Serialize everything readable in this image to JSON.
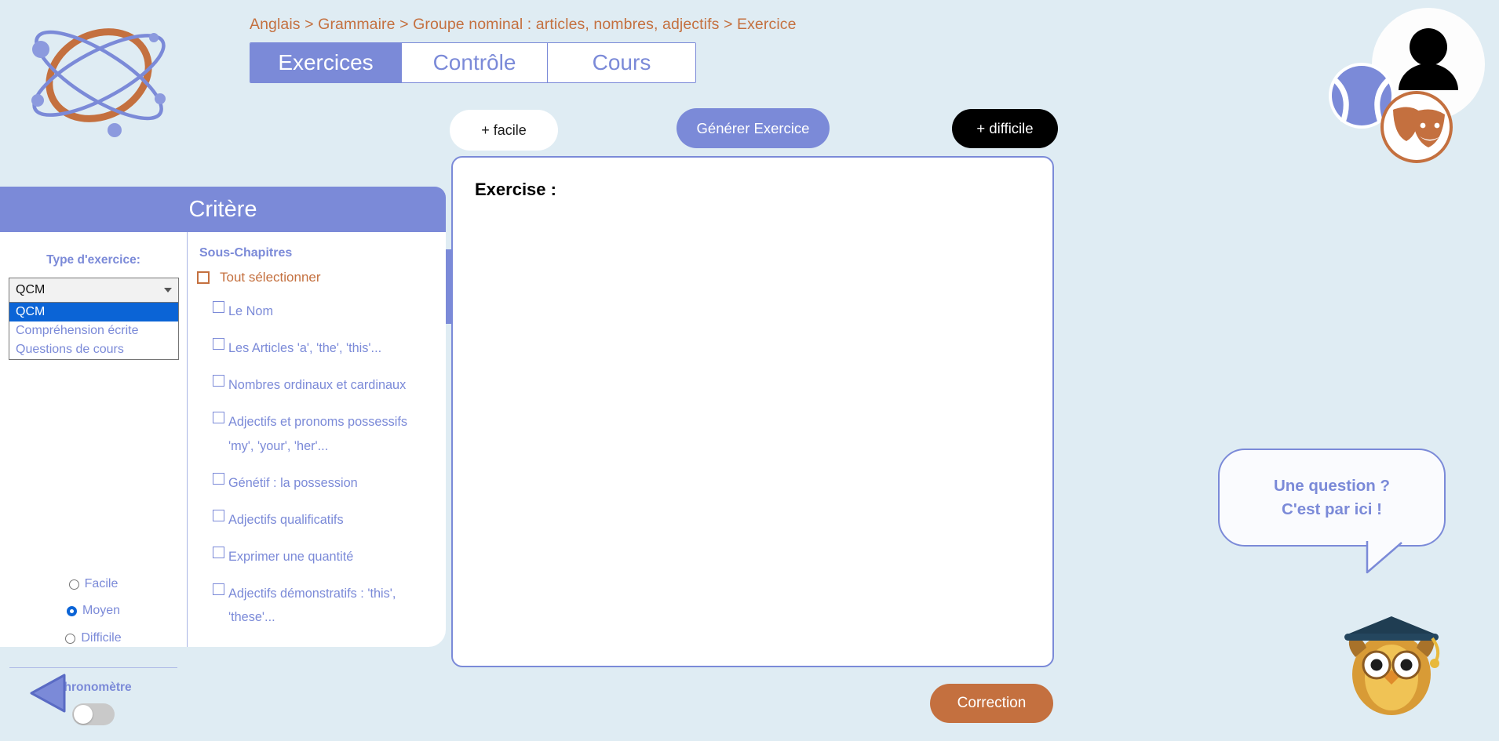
{
  "breadcrumb": {
    "text": "Anglais > Grammaire > Groupe nominal : articles, nombres, adjectifs > Exercice"
  },
  "tabs": [
    {
      "label": "Exercices",
      "active": true
    },
    {
      "label": "Contrôle",
      "active": false
    },
    {
      "label": "Cours",
      "active": false
    }
  ],
  "toolbar": {
    "easier_label": "+ facile",
    "generate_label": "Générer Exercice",
    "harder_label": "+ difficile"
  },
  "criteria": {
    "title": "Critère",
    "exercise_type_label": "Type d'exercice:",
    "exercise_type_value": "QCM",
    "exercise_type_options": [
      {
        "label": "QCM",
        "selected": true
      },
      {
        "label": "Compréhension écrite",
        "selected": false
      },
      {
        "label": "Questions de cours",
        "selected": false
      }
    ],
    "difficulty_options": [
      {
        "label": "Facile",
        "selected": false
      },
      {
        "label": "Moyen",
        "selected": true
      },
      {
        "label": "Difficile",
        "selected": false
      }
    ],
    "chronometer_label": "Chronomètre",
    "chronometer_on": false
  },
  "subchapters": {
    "title": "Sous-Chapitres",
    "select_all_label": "Tout sélectionner",
    "items": [
      {
        "label": "Le Nom",
        "checked": false
      },
      {
        "label": "Les Articles 'a', 'the', 'this'...",
        "checked": false
      },
      {
        "label": "Nombres ordinaux et cardinaux",
        "checked": false
      },
      {
        "label": "Adjectifs et pronoms possessifs 'my', 'your', 'her'...",
        "checked": false
      },
      {
        "label": "Génétif : la possession",
        "checked": false
      },
      {
        "label": "Adjectifs qualificatifs",
        "checked": false
      },
      {
        "label": "Exprimer une quantité",
        "checked": false
      },
      {
        "label": "Adjectifs démonstratifs : 'this', 'these'...",
        "checked": false
      }
    ]
  },
  "collapse": {
    "glyph": "«"
  },
  "exercise": {
    "title": "Exercise :",
    "body": ""
  },
  "footer": {
    "correction_label": "Correction"
  },
  "helper": {
    "line1": "Une question ?",
    "line2": "C'est par ici !"
  },
  "colors": {
    "background": "#dfecf3",
    "primary": "#7b8ad8",
    "accent_orange": "#c4703f",
    "highlight_blue": "#0b64d6",
    "black": "#000000"
  }
}
